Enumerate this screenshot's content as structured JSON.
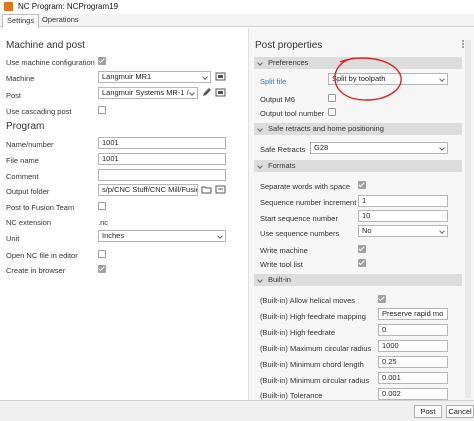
{
  "window": {
    "title": "NC Program: NCProgram19"
  },
  "tabs": [
    {
      "label": "Settings"
    },
    {
      "label": "Operations"
    }
  ],
  "left": {
    "machine_section": {
      "title": "Machine and post",
      "use_machine_config": {
        "label": "Use machine configuration",
        "checked": true
      },
      "machine": {
        "label": "Machine",
        "value": "Langmuir  MR1"
      },
      "post": {
        "label": "Post",
        "value": "Langmuir Systems MR-1 /"
      },
      "use_cascading_post": {
        "label": "Use cascading post",
        "checked": false
      }
    },
    "program_section": {
      "title": "Program",
      "name_number": {
        "label": "Name/number",
        "value": "1001"
      },
      "file_name": {
        "label": "File name",
        "value": "1001"
      },
      "comment": {
        "label": "Comment",
        "value": ""
      },
      "output_folder": {
        "label": "Output folder",
        "value": "s/p/CNC Stuff/CNC Mill/Fusion"
      },
      "post_to_fusion_team": {
        "label": "Post to Fusion Team",
        "checked": false
      },
      "nc_extension": {
        "label": "NC extension",
        "value": ".nc"
      },
      "unit": {
        "label": "Unit",
        "value": "Inches"
      },
      "open_nc_file": {
        "label": "Open NC file in editor",
        "checked": false
      },
      "create_in_browser": {
        "label": "Create in browser",
        "checked": true
      }
    }
  },
  "right": {
    "title": "Post properties",
    "preferences": {
      "header": "Preferences",
      "split_file": {
        "label": "Split file",
        "value": "Split by toolpath"
      },
      "output_m6": {
        "label": "Output M6",
        "checked": false
      },
      "output_tool_number": {
        "label": "Output tool number",
        "checked": false
      }
    },
    "safe_retracts": {
      "header": "Safe retracts and home positioning",
      "safe_retracts": {
        "label": "Safe Retracts",
        "value": "G28"
      }
    },
    "formats": {
      "header": "Formats",
      "separate_words": {
        "label": "Separate words with space",
        "checked": true
      },
      "seq_increment": {
        "label": "Sequence number increment",
        "value": "1"
      },
      "start_seq": {
        "label": "Start sequence number",
        "value": "10"
      },
      "use_seq": {
        "label": "Use sequence numbers",
        "value": "No"
      },
      "write_machine": {
        "label": "Write machine",
        "checked": true
      },
      "write_tool_list": {
        "label": "Write tool list",
        "checked": true
      }
    },
    "builtin": {
      "header": "Built-in",
      "allow_helical": {
        "label": "(Built-in) Allow helical moves",
        "checked": true
      },
      "high_feed_mapping": {
        "label": "(Built-in) High feedrate mapping",
        "value": "Preserve rapid mo"
      },
      "high_feedrate": {
        "label": "(Built-in) High feedrate",
        "value": "0"
      },
      "max_circular_radius": {
        "label": "(Built-in) Maximum circular radius",
        "value": "1000"
      },
      "min_chord_length": {
        "label": "(Built-in) Minimum chord length",
        "value": "0.25"
      },
      "min_circular_radius": {
        "label": "(Built-in) Minimum circular radius",
        "value": "0.001"
      },
      "tolerance": {
        "label": "(Built-in) Tolerance",
        "value": "0.002"
      }
    }
  },
  "footer": {
    "post_button": "Post",
    "cancel_button": "Cancel"
  },
  "colors": {
    "accent_icon": "#e2731b",
    "annotation_red": "#d7262b",
    "link_blue": "#2a7ab8"
  }
}
